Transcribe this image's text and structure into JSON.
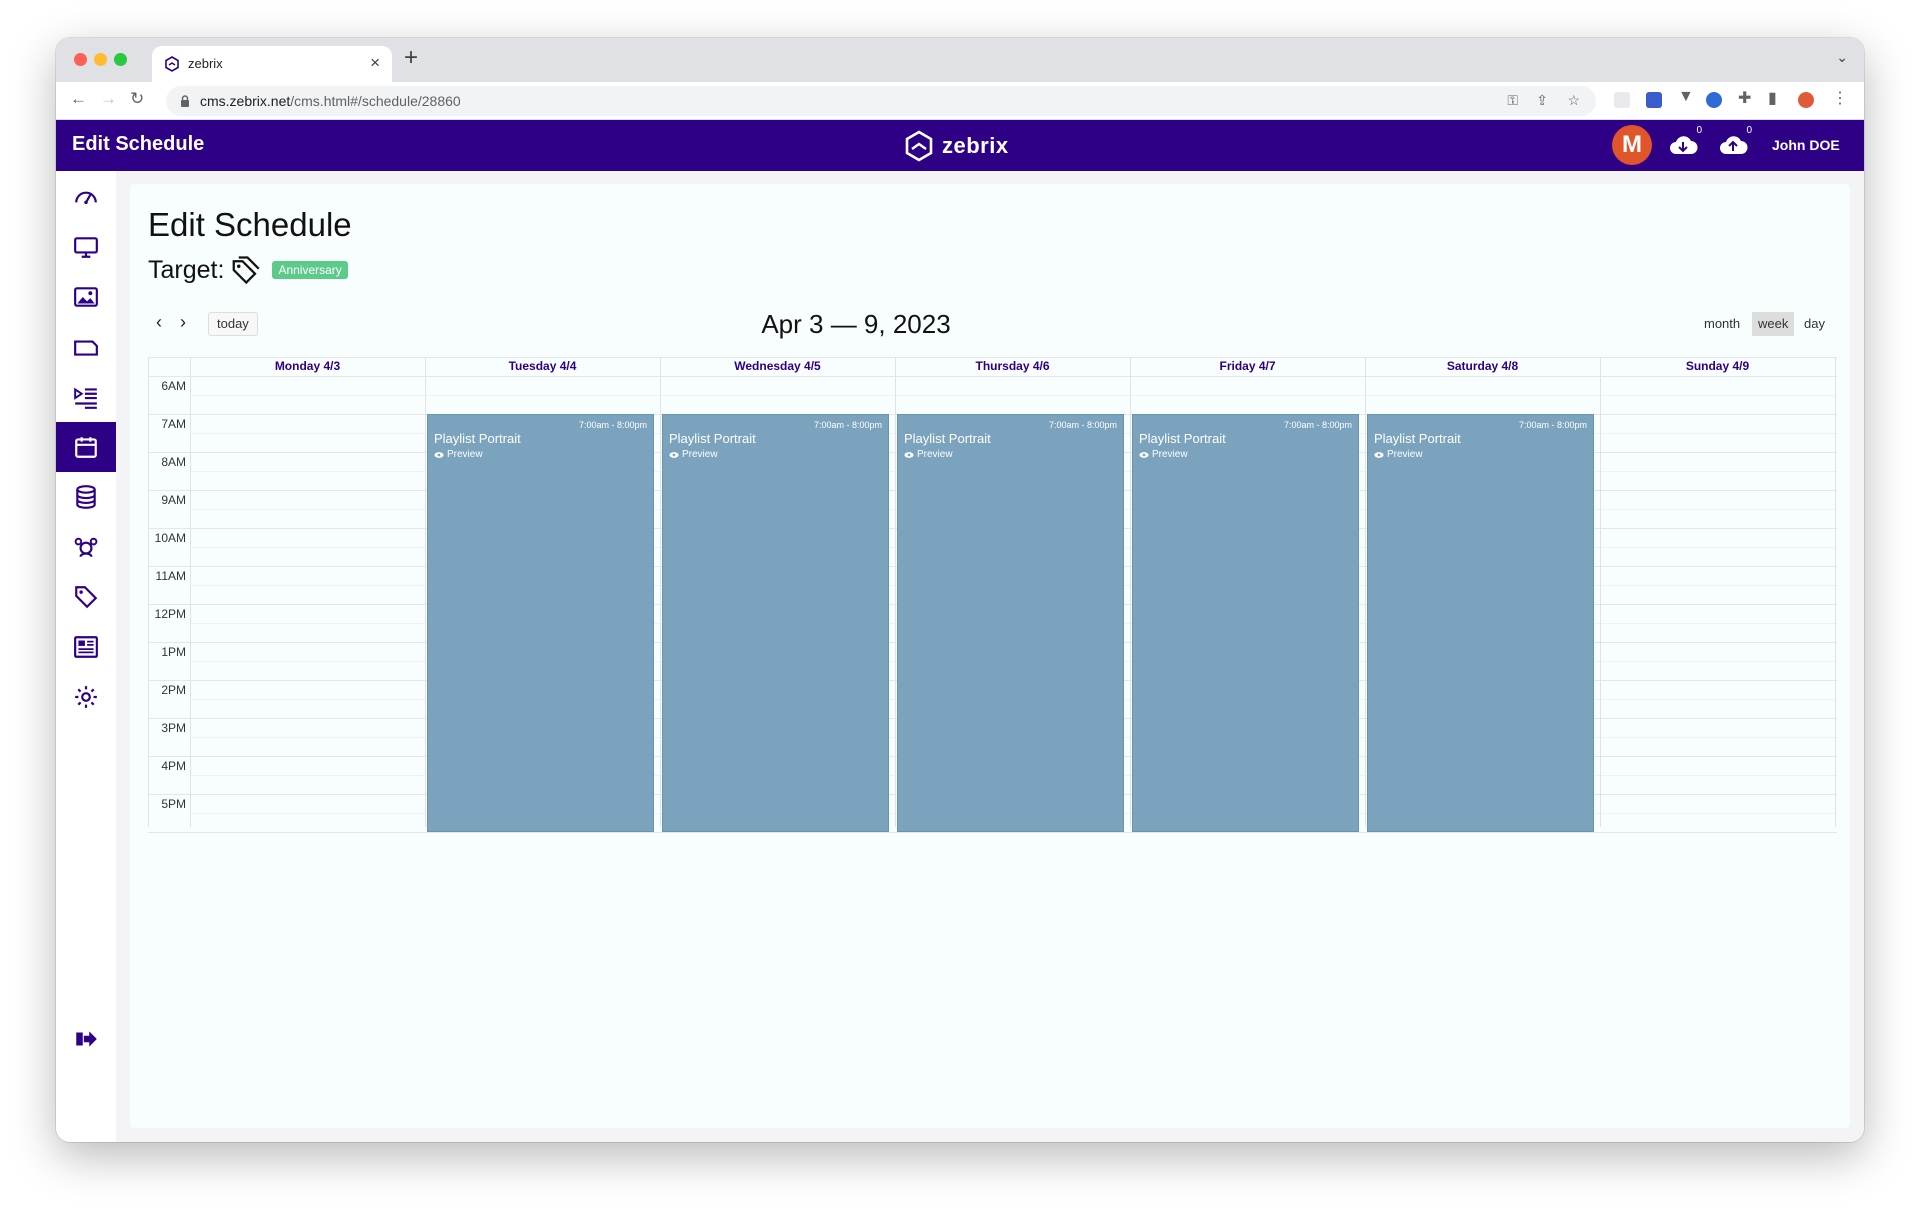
{
  "browser": {
    "tab_title": "zebrix",
    "url_host": "cms.zebrix.net",
    "url_path": "/cms.html#/schedule/28860"
  },
  "header": {
    "page_title": "Edit Schedule",
    "logo_text": "zebrix",
    "avatar_letter": "M",
    "download_count": "0",
    "upload_count": "0",
    "user_name": "John DOE"
  },
  "sidebar": {
    "items": [
      {
        "icon": "dashboard-icon"
      },
      {
        "icon": "monitor-icon"
      },
      {
        "icon": "image-icon"
      },
      {
        "icon": "folder-icon"
      },
      {
        "icon": "playlist-icon"
      },
      {
        "icon": "calendar-icon",
        "active": true
      },
      {
        "icon": "database-icon"
      },
      {
        "icon": "users-icon"
      },
      {
        "icon": "tag-icon"
      },
      {
        "icon": "news-icon"
      },
      {
        "icon": "settings-icon"
      }
    ],
    "logout_icon": "logout-icon"
  },
  "main": {
    "title": "Edit Schedule",
    "target_label": "Target:",
    "target_badge": "Anniversary",
    "today_label": "today",
    "range_title": "Apr 3 — 9, 2023",
    "views": {
      "month": "month",
      "week": "week",
      "day": "day",
      "selected": "week"
    }
  },
  "calendar": {
    "days": [
      "Monday 4/3",
      "Tuesday 4/4",
      "Wednesday 4/5",
      "Thursday 4/6",
      "Friday 4/7",
      "Saturday 4/8",
      "Sunday 4/9"
    ],
    "hours": [
      "6AM",
      "7AM",
      "8AM",
      "9AM",
      "10AM",
      "11AM",
      "12PM",
      "1PM",
      "2PM",
      "3PM",
      "4PM",
      "5PM"
    ],
    "events": [
      {
        "day": 1,
        "time": "7:00am - 8:00pm",
        "name": "Playlist Portrait",
        "preview": "Preview"
      },
      {
        "day": 2,
        "time": "7:00am - 8:00pm",
        "name": "Playlist Portrait",
        "preview": "Preview"
      },
      {
        "day": 3,
        "time": "7:00am - 8:00pm",
        "name": "Playlist Portrait",
        "preview": "Preview"
      },
      {
        "day": 4,
        "time": "7:00am - 8:00pm",
        "name": "Playlist Portrait",
        "preview": "Preview"
      },
      {
        "day": 5,
        "time": "7:00am - 8:00pm",
        "name": "Playlist Portrait",
        "preview": "Preview"
      }
    ]
  },
  "colors": {
    "brand": "#2d0086",
    "event_bg": "#7ba3be",
    "badge": "#5ccb8a"
  }
}
